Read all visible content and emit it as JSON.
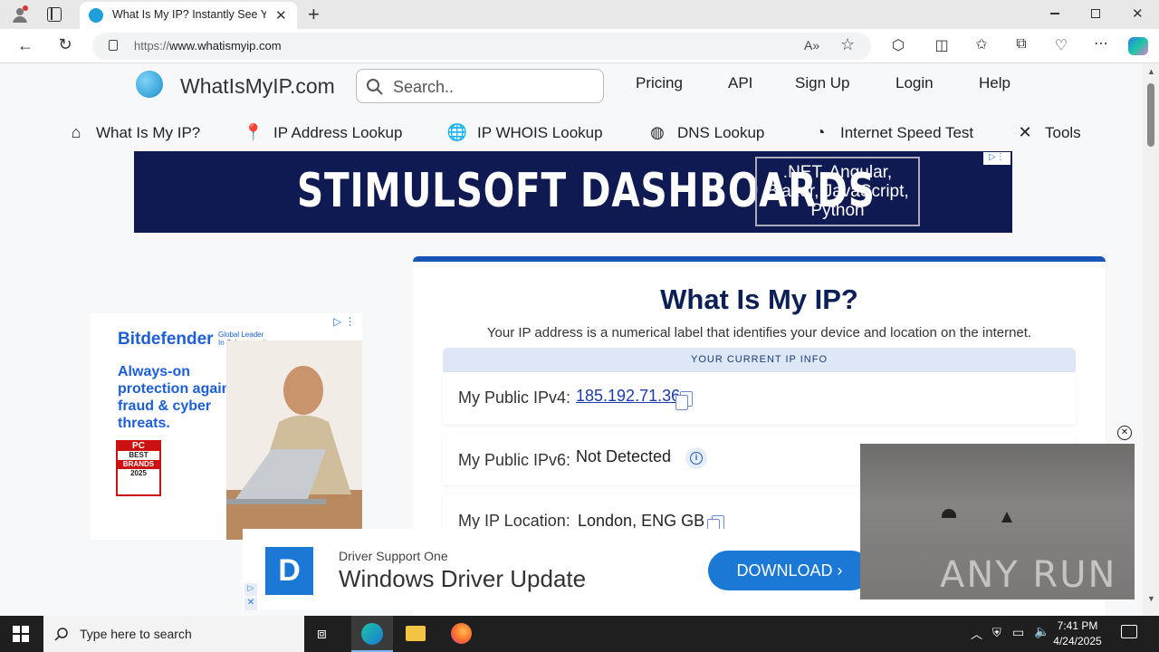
{
  "browser": {
    "tab_title": "What Is My IP? Instantly See Your",
    "url_prefix": "https://",
    "url_host": "www.whatismyip.com"
  },
  "site": {
    "logo_text": "WhatIsMyIP.com",
    "search_placeholder": "Search..",
    "top_nav": [
      "Pricing",
      "API",
      "Sign Up",
      "Login",
      "Help"
    ],
    "main_nav": [
      {
        "label": "What Is My IP?",
        "icon": "home-icon"
      },
      {
        "label": "IP Address Lookup",
        "icon": "map-pin-icon"
      },
      {
        "label": "IP WHOIS Lookup",
        "icon": "globe-icon"
      },
      {
        "label": "DNS Lookup",
        "icon": "dns-icon"
      },
      {
        "label": "Internet Speed Test",
        "icon": "speedometer-icon"
      },
      {
        "label": "Tools",
        "icon": "tools-icon"
      }
    ]
  },
  "banner_ad": {
    "headline": "STIMULSOFT DASHBOARDS",
    "box_text_1": ".NET, Angular,",
    "box_text_2": "Blazor, JavaScript,",
    "box_text_3": "Python"
  },
  "side_ad": {
    "brand": "Bitdefender",
    "tagline_1": "Global Leader",
    "tagline_2": "In Cybersecurity",
    "headline_1": "Always-on",
    "headline_2": "protection against",
    "headline_3": "fraud & cyber",
    "headline_4": "threats.",
    "badge_1": "PC",
    "badge_2": "BEST",
    "badge_3": "BRANDS",
    "badge_4": "2025"
  },
  "ip_card": {
    "title": "What Is My IP?",
    "subtitle": "Your IP address is a numerical label that identifies your device and location on the internet.",
    "section_header": "YOUR CURRENT IP INFO",
    "ipv4_label": "My Public IPv4:",
    "ipv4_value": "185.192.71.36",
    "ipv6_label": "My Public IPv6:",
    "ipv6_value": "Not Detected",
    "location_label": "My IP Location:",
    "location_value": "London, ENG GB"
  },
  "bottom_ad": {
    "company": "Driver Support One",
    "headline": "Windows Driver Update",
    "cta": "DOWNLOAD"
  },
  "video": {
    "watermark": "ANY RUN"
  },
  "taskbar": {
    "search_placeholder": "Type here to search",
    "time": "7:41 PM",
    "date": "4/24/2025"
  }
}
